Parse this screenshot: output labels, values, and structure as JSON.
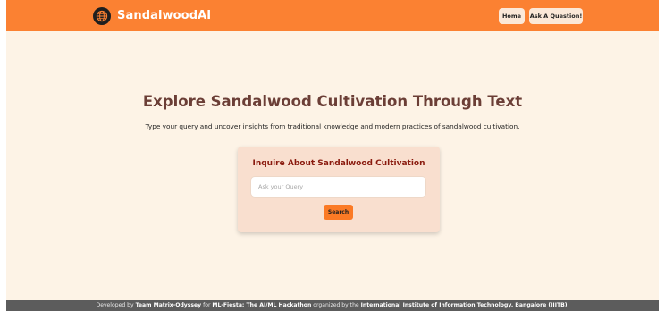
{
  "header": {
    "brand": "SandalwoodAI",
    "logo_icon": "globe-icon",
    "nav": {
      "home_label": "Home",
      "ask_label": "Ask A Question!"
    }
  },
  "hero": {
    "title": "Explore Sandalwood Cultivation Through Text",
    "subtitle": "Type your query and uncover insights from traditional knowledge and modern practices of sandalwood cultivation."
  },
  "inquiry": {
    "title": "Inquire About Sandalwood Cultivation",
    "placeholder": "Ask your Query",
    "value": "",
    "search_label": "Search"
  },
  "footer": {
    "prefix": "Developed by",
    "team": "Team Matrix-Odyssey",
    "for_text": "for",
    "event": "ML-Fiesta: The AI/ML Hackathon",
    "organized_text": "organized by the",
    "institute": "International Institute of Information Technology, Bangalore (IIITB)",
    "suffix": "."
  },
  "colors": {
    "header_bg": "#fb8132",
    "page_bg": "#fdf3e6",
    "title_color": "#6b3e36",
    "card_bg": "#f9dfcf",
    "card_title": "#8a1a0e",
    "button_bg": "#fb7a25",
    "footer_bg": "#5c5c5c"
  }
}
